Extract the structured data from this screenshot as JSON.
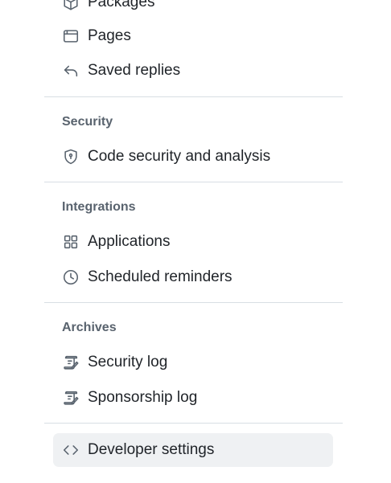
{
  "settings_nav": {
    "top_items": [
      {
        "label": "Packages",
        "icon": "package-icon"
      },
      {
        "label": "Pages",
        "icon": "browser-icon"
      },
      {
        "label": "Saved replies",
        "icon": "reply-icon"
      }
    ],
    "security": {
      "heading": "Security",
      "items": [
        {
          "label": "Code security and analysis",
          "icon": "shield-lock-icon"
        }
      ]
    },
    "integrations": {
      "heading": "Integrations",
      "items": [
        {
          "label": "Applications",
          "icon": "apps-icon"
        },
        {
          "label": "Scheduled reminders",
          "icon": "clock-icon"
        }
      ]
    },
    "archives": {
      "heading": "Archives",
      "items": [
        {
          "label": "Security log",
          "icon": "log-icon"
        },
        {
          "label": "Sponsorship log",
          "icon": "log-icon"
        }
      ]
    },
    "developer": {
      "label": "Developer settings",
      "icon": "code-icon",
      "selected": true
    }
  },
  "colors": {
    "text": "#1f2328",
    "muted": "#59636e",
    "divider": "#d8dee4",
    "selected_bg": "#eff1f3"
  }
}
